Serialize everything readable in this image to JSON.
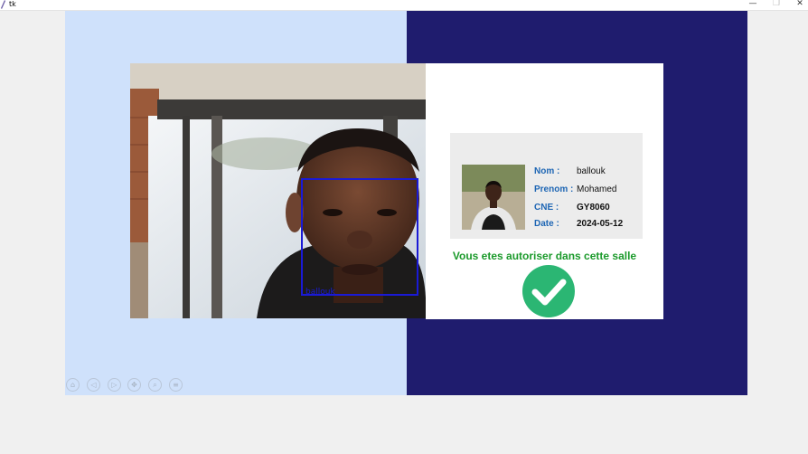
{
  "window": {
    "title": "tk",
    "min": "—",
    "max": "❐",
    "close": "✕"
  },
  "camera": {
    "face_label": "ballouk"
  },
  "info": {
    "fields": [
      {
        "label": "Nom :",
        "value": "ballouk"
      },
      {
        "label": "Prenom :",
        "value": "Mohamed"
      },
      {
        "label": "CNE :",
        "value": "GY8060"
      },
      {
        "label": "Date :",
        "value": "2024-05-12"
      }
    ],
    "message": "Vous etes autoriser dans cette salle"
  },
  "colors": {
    "left_panel": "#cfe1fb",
    "right_panel": "#1f1c6e",
    "label_blue": "#1e66b4",
    "success_green": "#1b9a2b",
    "face_box": "#1a1ad6"
  },
  "toolbar": {
    "icons": [
      "home-icon",
      "back-icon",
      "forward-icon",
      "pan-icon",
      "zoom-icon",
      "settings-icon"
    ],
    "glyphs": [
      "⌂",
      "◁",
      "▷",
      "✥",
      "⌕",
      "≡"
    ]
  }
}
